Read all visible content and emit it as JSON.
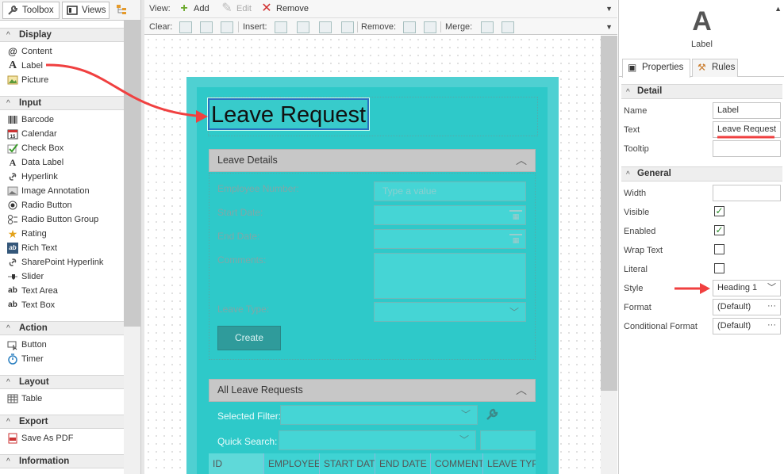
{
  "toolbox": {
    "tabs": {
      "toolbox": "Toolbox",
      "views": "Views"
    },
    "sections": [
      {
        "key": "display",
        "title": "Display",
        "items": [
          "Content",
          "Label",
          "Picture"
        ]
      },
      {
        "key": "input",
        "title": "Input",
        "items": [
          "Barcode",
          "Calendar",
          "Check Box",
          "Data Label",
          "Hyperlink",
          "Image Annotation",
          "Radio Button",
          "Radio Button Group",
          "Rating",
          "Rich Text",
          "SharePoint Hyperlink",
          "Slider",
          "Text Area",
          "Text Box"
        ]
      },
      {
        "key": "action",
        "title": "Action",
        "items": [
          "Button",
          "Timer"
        ]
      },
      {
        "key": "layout",
        "title": "Layout",
        "items": [
          "Table"
        ]
      },
      {
        "key": "export",
        "title": "Export",
        "items": [
          "Save As PDF"
        ]
      },
      {
        "key": "information",
        "title": "Information",
        "items": []
      }
    ]
  },
  "toolbar": {
    "view_label": "View:",
    "add": "Add",
    "edit": "Edit",
    "remove": "Remove",
    "clear_label": "Clear:",
    "insert_label": "Insert:",
    "remove_label": "Remove:",
    "merge_label": "Merge:"
  },
  "form": {
    "title": "Leave Request",
    "details_panel": "Leave Details",
    "fields": {
      "employee_number": "Employee Number:",
      "employee_number_placeholder": "Type a value",
      "start_date": "Start Date:",
      "end_date": "End Date:",
      "comments": "Comments:",
      "leave_type": "Leave Type:"
    },
    "create_button": "Create",
    "list_panel": "All Leave Requests",
    "selected_filter": "Selected Filter:",
    "quick_search": "Quick Search:",
    "columns": [
      "ID",
      "EMPLOYEE",
      "START DATE",
      "END DATE",
      "COMMENT",
      "LEAVE TYPE"
    ]
  },
  "properties": {
    "control_icon": "A",
    "control_name": "Label",
    "tabs": {
      "properties": "Properties",
      "rules": "Rules"
    },
    "detail_section": "Detail",
    "general_section": "General",
    "name_label": "Name",
    "name_value": "Label",
    "text_label": "Text",
    "text_value": "Leave Request",
    "tooltip_label": "Tooltip",
    "tooltip_value": "",
    "width_label": "Width",
    "width_value": "",
    "visible_label": "Visible",
    "visible_checked": true,
    "enabled_label": "Enabled",
    "enabled_checked": true,
    "wrap_label": "Wrap Text",
    "wrap_checked": false,
    "literal_label": "Literal",
    "literal_checked": false,
    "style_label": "Style",
    "style_value": "Heading 1",
    "format_label": "Format",
    "format_value": "(Default)",
    "cond_format_label": "Conditional Format",
    "cond_format_value": "(Default)"
  },
  "colors": {
    "form_background": "#2ec9c9",
    "panel_header": "#c7c7c7",
    "button": "#2f9b9b",
    "annotation": "#f04040",
    "selection": "#2a6fc0"
  }
}
